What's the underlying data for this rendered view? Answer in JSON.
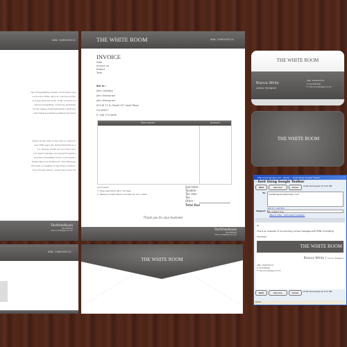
{
  "brand": "THE WHITE ROOM",
  "brand_compact": "TheWhiteRoom",
  "abn": "ABN: 31690035131",
  "letterhead": {
    "para1": [
      "ing and typesetting industry. Lorem Ipsum has",
      "e since the 1500s, when an unknown printer",
      "ce a type specimen book. It has survived not",
      "ectronic typesetting, remaining essentially",
      "ith the release of Letraset sheets containing",
      "with desktop publishing software like Aldus",
      "."
    ],
    "para2": [
      "simply random text. It has roots in a piece of",
      "over 2000 years old. Richard McClintock, a",
      "e in Virginia, looked up one of the more",
      "rem Ipsum passage, and going through the",
      "ered the undoubtable source. Lorem Ipsum",
      "Finibus Bonorum et Malorum\" (The Extremes",
      "this book is a treatise on the theory of ethics,",
      "t line of Lorem Ipsum, \"Lorem ipsum dolor sit"
    ],
    "footer_phone": "0413383540",
    "footer_email": "bianca.w7@bigpond.com"
  },
  "invoice": {
    "title": "INVOICE",
    "fields": [
      "Date",
      "Invoice no",
      "Project",
      "Term"
    ],
    "bill_to_label": "Bill to :",
    "bill_to": [
      "John Lewitsky",
      "John Enterprise",
      "John Enterprise",
      "670 W 17 th Street G2 Costa Mesa",
      "CA 92627",
      "P: 408 779 5659"
    ],
    "col_description": "Description",
    "col_amount": "Amount",
    "comments_label": "Comments :",
    "comments": [
      "1. Total payments die in 30 days",
      "2. Please include special number for your check"
    ],
    "totals": [
      "Sub total :",
      "Taxable :",
      "Tax rate :",
      "Tax :",
      "Other :"
    ],
    "total_due": "Total Due",
    "thanks": "Thank you for your business"
  },
  "card": {
    "name": "Bianca White",
    "role": "colour designer",
    "abn": "ABN: 31690035131",
    "phone": "P: 0413383540",
    "email": "E: bianca.w7@bigpond.com"
  },
  "gmail": {
    "window_title": "http://mail.google.com - Gmail - - Sent Using Google Toolbar",
    "heading": "- Sent Using Google Toolbar",
    "send": "Send",
    "save": "Save Now",
    "discard": "Discard",
    "draft_status": "Draft autosaved at 3:21 PM",
    "to_label": "To:",
    "to_value": "anotherperson@domain.com",
    "add_cc": "Add Cc",
    "add_bcc": "Add Bcc",
    "subject_label": "Subject:",
    "subject_value": "My subject line",
    "attach": "Attach a file",
    "invite": "Add event invitation",
    "body_hi": "Hi,",
    "body_text": "This is an example of me sending a Gmail message with HTML formatting",
    "body_sign": "Sincerely,",
    "sig_name": "Bianca White",
    "sig_sep": "|",
    "sig_role": "colour designer",
    "status": "Done"
  }
}
